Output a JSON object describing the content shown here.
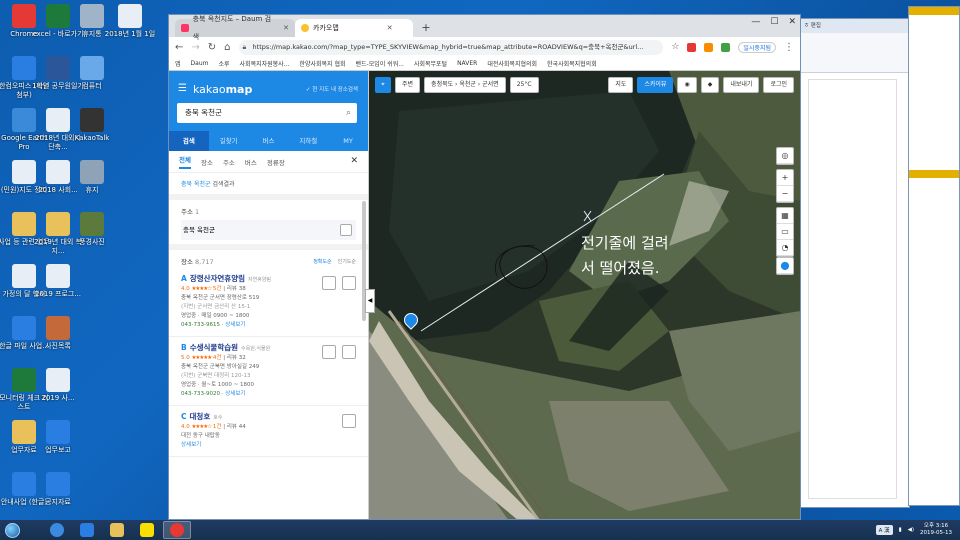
{
  "desktop_icons": [
    {
      "label": "Chrome",
      "icon": "chrome-icon",
      "color": "#e53935"
    },
    {
      "label": "excel - 바로가기",
      "icon": "excel-icon",
      "color": "#1d7a3a"
    },
    {
      "label": "휴지통",
      "icon": "recycle-bin-icon",
      "color": "#9fb4c9"
    },
    {
      "label": "2018년 1월 1일",
      "icon": "document-icon",
      "color": "#e8eef6"
    },
    {
      "label": "한컴오피스 (파일첨부)",
      "icon": "hancom-icon",
      "color": "#2a7de1"
    },
    {
      "label": "1학년 공무원일기",
      "icon": "word-icon",
      "color": "#2b579a"
    },
    {
      "label": "컴퓨터",
      "icon": "computer-icon",
      "color": "#6aa9e9"
    },
    {
      "label": "Google Earth Pro",
      "icon": "google-earth-icon",
      "color": "#3b8ad9"
    },
    {
      "label": "2018년 대외시 단축...",
      "icon": "document-icon",
      "color": "#e8eef6"
    },
    {
      "label": "KakaoTalk",
      "icon": "kakaotalk-icon",
      "color": "#333333"
    },
    {
      "label": "(민원)지도 정리",
      "icon": "document-icon",
      "color": "#e8eef6"
    },
    {
      "label": "2018 사회...",
      "icon": "document-icon",
      "color": "#e8eef6"
    },
    {
      "label": "휴지",
      "icon": "printer-icon",
      "color": "#8fa3b8"
    },
    {
      "label": "사업 등 관련 업무",
      "icon": "folder-icon",
      "color": "#e8c15a"
    },
    {
      "label": "2019년 대외 복지...",
      "icon": "folder-icon",
      "color": "#e8c15a"
    },
    {
      "label": "풍경사진",
      "icon": "photo-icon",
      "color": "#5b7a3c"
    },
    {
      "label": "가정의 달 행사",
      "icon": "document-icon",
      "color": "#e8eef6"
    },
    {
      "label": "2019 프로그...",
      "icon": "document-icon",
      "color": "#e8eef6"
    },
    {
      "label": "한글 파일 사업...",
      "icon": "hwp-icon",
      "color": "#2a7de1"
    },
    {
      "label": "사진목록",
      "icon": "photo-icon",
      "color": "#c46a3a"
    },
    {
      "label": "모니터링 체크 리스트",
      "icon": "spreadsheet-icon",
      "color": "#1d7a3a"
    },
    {
      "label": "2019 사...",
      "icon": "document-icon",
      "color": "#e8eef6"
    },
    {
      "label": "업무자료",
      "icon": "folder-icon",
      "color": "#e8c15a"
    },
    {
      "label": "업무보고",
      "icon": "hwp-icon",
      "color": "#2a7de1"
    },
    {
      "label": "안내사업 (한글)",
      "icon": "hwp-icon",
      "color": "#2a7de1"
    },
    {
      "label": "공지자료",
      "icon": "hwp-icon",
      "color": "#2a7de1"
    }
  ],
  "browser": {
    "tabs": [
      {
        "title": "충북 옥천지도 – Daum 검색",
        "active": false
      },
      {
        "title": "카카오맵",
        "active": true
      }
    ],
    "url": "https://map.kakao.com/?map_type=TYPE_SKYVIEW&map_hybrid=true&map_attribute=ROADVIEW&q=충북+옥천군&url...",
    "bookmarks": [
      "앱",
      "Daum",
      "소루",
      "사회복지자원봉사...",
      "한양사회복지 협회",
      "밴드-모임이 쉬워...",
      "사회복무포털",
      "NAVER",
      "대전사회복지협의회",
      "한국사회복지협의회"
    ],
    "extension_label": "일시중지됨"
  },
  "kakao": {
    "logo_bold": "kakao",
    "logo_rest": "map",
    "search_option": "현 지도 내 장소검색",
    "search_value": "충북 옥천군",
    "tabs": [
      "검색",
      "길찾기",
      "버스",
      "지하철",
      "MY"
    ],
    "filters": [
      "전체",
      "장소",
      "주소",
      "버스",
      "정류장"
    ],
    "keyword_result_region": "충북 옥천군",
    "keyword_result_suffix": "검색결과",
    "address_section": "주소",
    "address_count": "1",
    "address_value": "충북 옥천군",
    "place_section": "장소",
    "place_count": "8,717",
    "sort_accuracy": "정확도순",
    "sort_popular": "인기도순",
    "places": [
      {
        "letter": "A",
        "name": "장령산자연휴양림",
        "category": "자연휴양림",
        "rating": "4.0",
        "stars": "★★★★☆",
        "reviews": "5건",
        "reviews_label": "리뷰 38",
        "address": "충북 옥천군 군서면 장령산로 519",
        "jibun": "(지번) 군서면 금산리 산 15-1",
        "hours": "영업중 · 매일 0900 ~ 1800",
        "phone": "043-733-9615",
        "detail": "상세보기"
      },
      {
        "letter": "B",
        "name": "수생식물학습원",
        "category": "수목원,식물원",
        "rating": "5.0",
        "stars": "★★★★★",
        "reviews": "4건",
        "reviews_label": "리뷰 32",
        "address": "충북 옥천군 군북면 방아실길 249",
        "jibun": "(지번) 군북면 대정리 120-13",
        "hours": "영업중 · 월~토 1000 ~ 1800",
        "phone": "043-733-9020",
        "detail": "상세보기"
      },
      {
        "letter": "C",
        "name": "대청호",
        "category": "호수",
        "rating": "4.0",
        "stars": "★★★★☆",
        "reviews": "1건",
        "reviews_label": "리뷰 44",
        "address": "대전 동구 내탑동",
        "jibun": "",
        "hours": "",
        "phone": "",
        "detail": "상세보기"
      }
    ]
  },
  "map": {
    "toolbar": {
      "roadview": "주변",
      "breadcrumb": "충청북도 › 옥천군 › 군서면",
      "weather": "25°C",
      "map_btn": "지도",
      "skyview_btn": "스카이뷰",
      "share": "내보내기",
      "login": "로그인"
    },
    "annotation_line1": "전기줄에 걸려",
    "annotation_line2": "서 떨어졌음."
  },
  "taskbar": {
    "apps": [
      {
        "icon": "ie-icon",
        "color": "#3a8be0"
      },
      {
        "icon": "hwp-icon",
        "color": "#2a7de1"
      },
      {
        "icon": "folder-icon",
        "color": "#e8c15a"
      },
      {
        "icon": "kakaotalk-icon",
        "color": "#f9e000"
      },
      {
        "icon": "chrome-icon",
        "color": "#e53935"
      }
    ],
    "ime": "A 漢",
    "time": "오후 3:16",
    "date": "2019-05-13"
  }
}
